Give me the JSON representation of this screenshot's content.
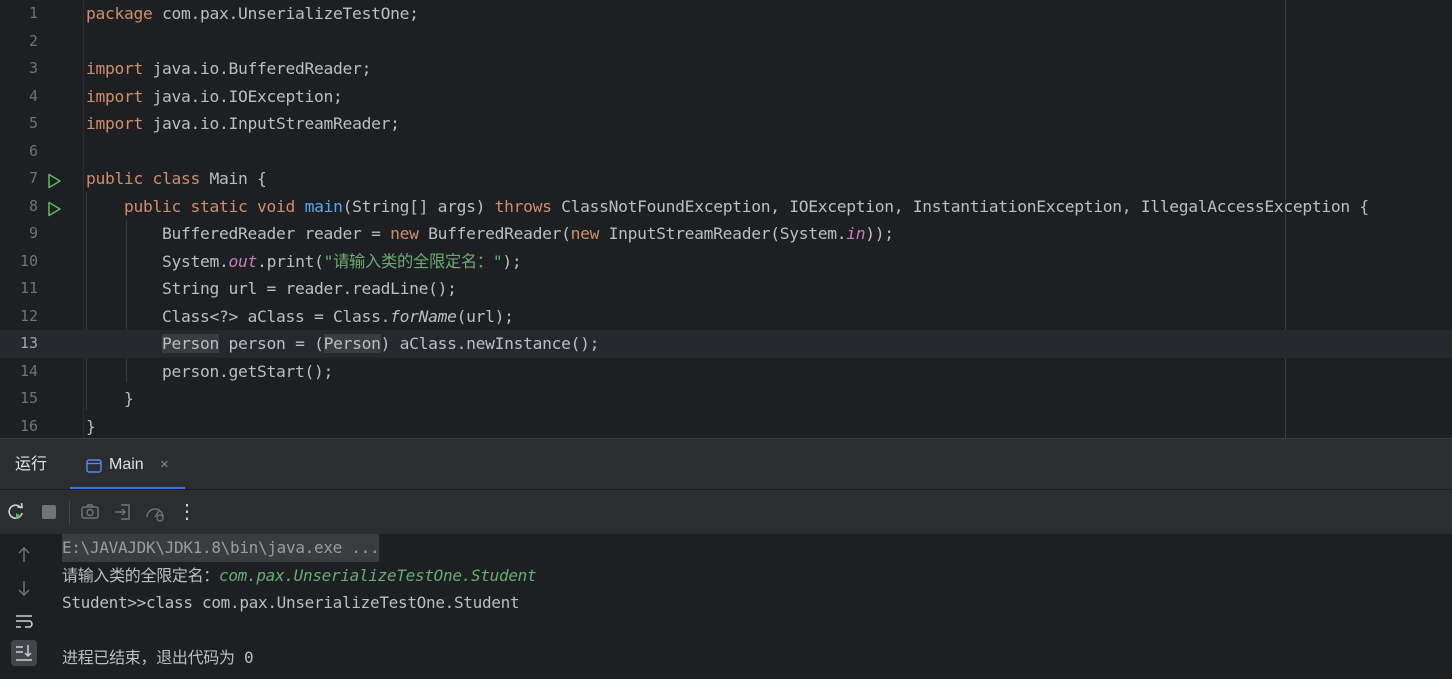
{
  "editor": {
    "current_line": 13,
    "lines": [
      {
        "n": "1",
        "runnable": false,
        "tokens": [
          {
            "t": "package",
            "c": "kw"
          },
          {
            "t": " com.pax.UnserializeTestOne;"
          }
        ]
      },
      {
        "n": "2",
        "runnable": false,
        "tokens": []
      },
      {
        "n": "3",
        "runnable": false,
        "tokens": [
          {
            "t": "import",
            "c": "kw"
          },
          {
            "t": " java.io.BufferedReader;"
          }
        ]
      },
      {
        "n": "4",
        "runnable": false,
        "tokens": [
          {
            "t": "import",
            "c": "kw"
          },
          {
            "t": " java.io.IOException;"
          }
        ]
      },
      {
        "n": "5",
        "runnable": false,
        "tokens": [
          {
            "t": "import",
            "c": "kw"
          },
          {
            "t": " java.io.InputStreamReader;"
          }
        ]
      },
      {
        "n": "6",
        "runnable": false,
        "tokens": []
      },
      {
        "n": "7",
        "runnable": true,
        "tokens": [
          {
            "t": "public class",
            "c": "kw"
          },
          {
            "t": " Main {"
          }
        ]
      },
      {
        "n": "8",
        "runnable": true,
        "tokens": [
          {
            "t": "    "
          },
          {
            "t": "public static void",
            "c": "kw"
          },
          {
            "t": " "
          },
          {
            "t": "main",
            "c": "fn"
          },
          {
            "t": "(String[] args) "
          },
          {
            "t": "throws",
            "c": "kw"
          },
          {
            "t": " ClassNotFoundException, IOException, InstantiationException, IllegalAccessException {"
          }
        ]
      },
      {
        "n": "9",
        "runnable": false,
        "tokens": [
          {
            "t": "        BufferedReader reader = "
          },
          {
            "t": "new",
            "c": "kw"
          },
          {
            "t": " BufferedReader("
          },
          {
            "t": "new",
            "c": "kw"
          },
          {
            "t": " InputStreamReader(System."
          },
          {
            "t": "in",
            "c": "fld"
          },
          {
            "t": "));"
          }
        ]
      },
      {
        "n": "10",
        "runnable": false,
        "tokens": [
          {
            "t": "        System."
          },
          {
            "t": "out",
            "c": "fld"
          },
          {
            "t": ".print("
          },
          {
            "t": "\"请输入类的全限定名：\"",
            "c": "str"
          },
          {
            "t": ");"
          }
        ]
      },
      {
        "n": "11",
        "runnable": false,
        "tokens": [
          {
            "t": "        String url = reader.readLine();"
          }
        ]
      },
      {
        "n": "12",
        "runnable": false,
        "tokens": [
          {
            "t": "        Class<?> aClass = Class."
          },
          {
            "t": "forName",
            "c": "it"
          },
          {
            "t": "(url);"
          }
        ]
      },
      {
        "n": "13",
        "runnable": false,
        "tokens": [
          {
            "t": "        "
          },
          {
            "t": "Person",
            "c": "hl"
          },
          {
            "t": " person = ("
          },
          {
            "t": "Person",
            "c": "hl"
          },
          {
            "t": ") aClass.newInstance();"
          }
        ]
      },
      {
        "n": "14",
        "runnable": false,
        "tokens": [
          {
            "t": "        person.getStart();"
          }
        ]
      },
      {
        "n": "15",
        "runnable": false,
        "tokens": [
          {
            "t": "    }"
          }
        ]
      },
      {
        "n": "16",
        "runnable": false,
        "tokens": [
          {
            "t": "}"
          }
        ]
      }
    ]
  },
  "run_panel": {
    "title": "运行",
    "tab": {
      "label": "Main",
      "close": "×"
    }
  },
  "toolbar": {
    "icons": [
      "rerun-icon",
      "stop-icon",
      "screenshot-icon",
      "restore-layout-icon",
      "profiler-icon",
      "more-vertical-icon"
    ],
    "more": "⋮"
  },
  "console": {
    "command": "E:\\JAVAJDK\\JDK1.8\\bin\\java.exe ...",
    "prompt": "请输入类的全限定名：",
    "user_input": "com.pax.UnserializeTestOne.Student",
    "output_line": "Student>>class com.pax.UnserializeTestOne.Student",
    "exit_message": "进程已结束，退出代码为 0"
  },
  "colors": {
    "keyword": "#cf8e6d",
    "function": "#56a8f5",
    "string": "#6aab73",
    "static_field": "#c77dbb",
    "accent": "#3574f0"
  }
}
